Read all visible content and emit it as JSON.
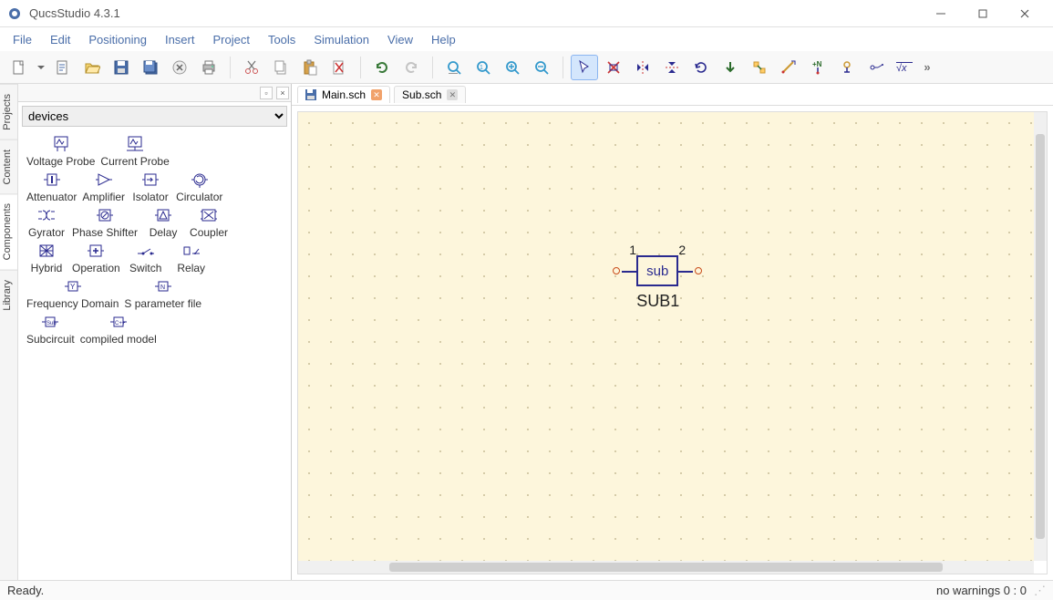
{
  "app": {
    "title": "QucsStudio 4.3.1"
  },
  "menu": [
    "File",
    "Edit",
    "Positioning",
    "Insert",
    "Project",
    "Tools",
    "Simulation",
    "View",
    "Help"
  ],
  "toolbar_icons": [
    "new",
    "new-dropdown",
    "open",
    "save",
    "save-all",
    "print",
    "close",
    "print-preview",
    "sep",
    "cut",
    "copy",
    "paste",
    "delete",
    "sep2",
    "undo",
    "redo",
    "sep3",
    "zoom-fit",
    "zoom-1",
    "zoom-in",
    "zoom-out",
    "sep4",
    "cursor",
    "deactivate",
    "mirror-h",
    "mirror-v",
    "rotate",
    "downarrow",
    "align",
    "wire",
    "label",
    "port",
    "equation",
    "formula",
    "overflow"
  ],
  "sidepanel": {
    "title_buttons": {
      "undock": "▫",
      "close": "×"
    },
    "category": "devices",
    "vtabs": [
      "Projects",
      "Content",
      "Components",
      "Library"
    ],
    "active_vtab": "Components",
    "rows": [
      [
        "Voltage Probe",
        "Current Probe"
      ],
      [
        "Attenuator",
        "Amplifier",
        "Isolator",
        "Circulator"
      ],
      [
        "Gyrator",
        "Phase Shifter",
        "Delay",
        "Coupler"
      ],
      [
        "Hybrid",
        "Operation",
        "Switch",
        "Relay"
      ],
      [
        "Frequency Domain",
        "S parameter file"
      ],
      [
        "Subcircuit",
        "compiled model"
      ]
    ]
  },
  "tabs": [
    {
      "name": "Main.sch",
      "active": true,
      "dirty": true
    },
    {
      "name": "Sub.sch",
      "active": false,
      "dirty": false
    }
  ],
  "schematic": {
    "component": {
      "box_text": "sub",
      "label": "SUB1",
      "pin1": "1",
      "pin2": "2"
    }
  },
  "status": {
    "left": "Ready.",
    "right": "no warnings  0 : 0"
  }
}
